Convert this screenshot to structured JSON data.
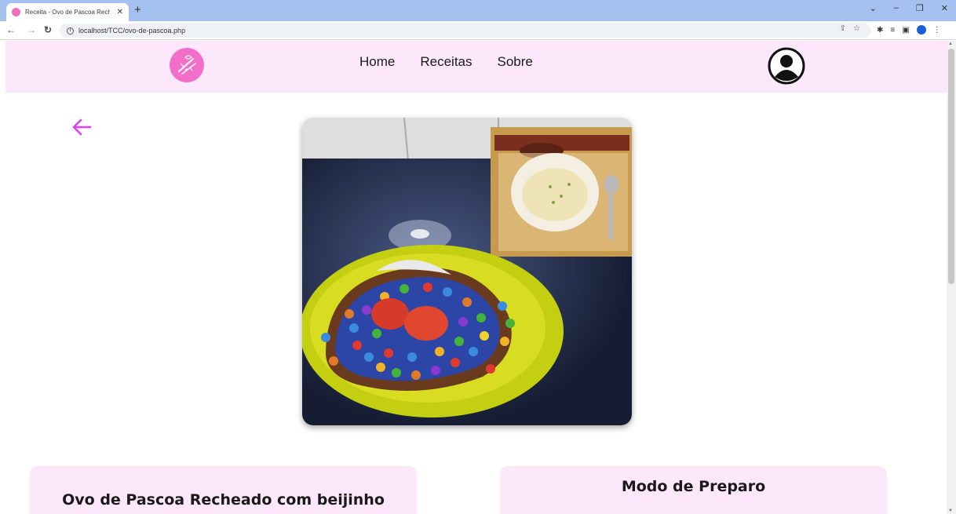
{
  "browser": {
    "tab_title": "Receita - Ovo de Pascoa Recheado",
    "new_tab": "+",
    "tab_close": "✕",
    "url": "localhost/TCC/ovo-de-pascoa.php",
    "window_buttons": [
      "⌄",
      "–",
      "❐",
      "✕"
    ]
  },
  "nav": {
    "items": [
      "Home",
      "Receitas",
      "Sobre"
    ]
  },
  "recipe": {
    "title": "Ovo de Pascoa Recheado com beijinho",
    "section_title": "Modo de Preparo"
  },
  "colors": {
    "accent": "#f36ec8",
    "header_bg": "#fde8fb",
    "back_arrow": "#e040fb"
  }
}
